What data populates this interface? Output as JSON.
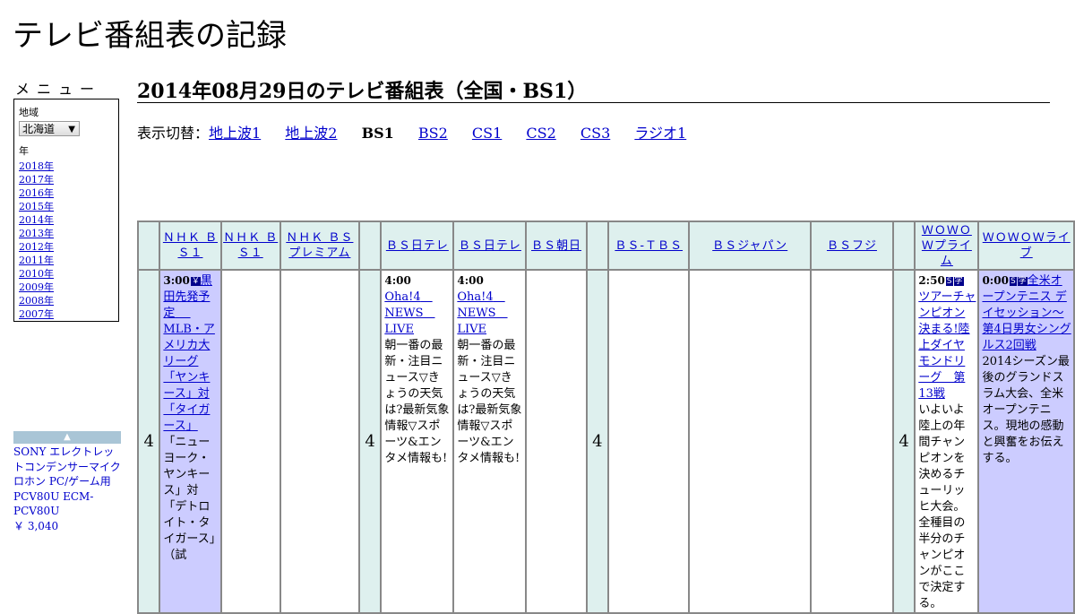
{
  "site": {
    "title": "テレビ番組表の記録"
  },
  "menu": {
    "label": "メニュー",
    "region_label": "地域",
    "region_value": "北海道",
    "year_label": "年",
    "years": [
      "2018年",
      "2017年",
      "2016年",
      "2015年",
      "2014年",
      "2013年",
      "2012年",
      "2011年",
      "2010年",
      "2009年",
      "2008年",
      "2007年"
    ]
  },
  "ad": {
    "caret": "▲",
    "text": "SONY エレクトレットコンデンサーマイクロホン PC/ゲーム用 PCV80U ECM-PCV80U",
    "price": "￥ 3,040"
  },
  "page": {
    "title": "2014年08月29日のテレビ番組表（全国・BS1）",
    "switch_label": "表示切替：",
    "switch_tabs": [
      {
        "label": "地上波1",
        "current": false
      },
      {
        "label": "地上波2",
        "current": false
      },
      {
        "label": "BS1",
        "current": true
      },
      {
        "label": "BS2",
        "current": false
      },
      {
        "label": "CS1",
        "current": false
      },
      {
        "label": "CS2",
        "current": false
      },
      {
        "label": "CS3",
        "current": false
      },
      {
        "label": "ラジオ1",
        "current": false
      }
    ]
  },
  "table": {
    "hour": "4",
    "channels": [
      "ＮＨＫ ＢＳ１",
      "ＮＨＫ ＢＳ１",
      "ＮＨＫ ＢＳプレミアム",
      "ＢＳ日テレ",
      "ＢＳ日テレ",
      "ＢＳ朝日",
      "ＢＳ-ＴＢＳ",
      "ＢＳジャパン",
      "ＢＳフジ",
      "ＷＯＷＯＷプライム",
      "ＷＯＷＯＷライブ"
    ],
    "programs": {
      "nhkbs1": {
        "time": "3:00",
        "badge": "￥",
        "title": "黒田先発予定　 MLB・アメリカ大リーグ「ヤンキース」対「タイガース」",
        "desc": "「ニューヨーク・ヤンキース」対「デトロイト・タイガース」（試"
      },
      "bsntv1": {
        "time": "4:00",
        "title": "Oha!4　NEWS　LIVE",
        "desc": "朝一番の最新・注目ニュース▽きょうの天気は?最新気象情報▽スポーツ&エンタメ情報も!"
      },
      "bsntv2": {
        "time": "4:00",
        "title": "Oha!4　NEWS　LIVE",
        "desc": "朝一番の最新・注目ニュース▽きょうの天気は?最新気象情報▽スポーツ&エンタメ情報も!"
      },
      "wowow_prime": {
        "time": "2:50",
        "badge1": "S",
        "badge2": "字",
        "title": "ツアーチャンピオン決まる!陸上ダイヤモンドリーグ　第13戦",
        "desc": "いよいよ陸上の年間チャンピオンを決めるチューリッヒ大会。全種目の半分のチャンピオンがここで決定する。"
      },
      "wowow_live": {
        "time": "0:00",
        "badge1": "S",
        "badge2": "字",
        "title": "全米オープンテニス デイセッション～第4日男女シングルス2回戦",
        "desc": "2014シーズン最後のグランドスラム大会、全米オープンテニス。現地の感動と興奮をお伝えする。"
      }
    }
  }
}
